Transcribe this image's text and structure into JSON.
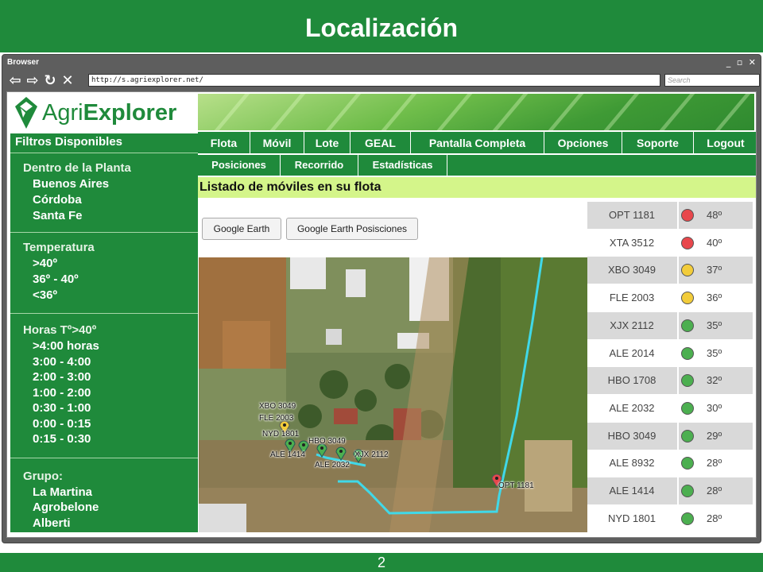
{
  "slide": {
    "title": "Localización",
    "page_number": "2"
  },
  "browser": {
    "title": "Browser",
    "url": "http://s.agriexplorer.net/",
    "search_placeholder": "Search",
    "window_controls": "_ ▫ ✕"
  },
  "logo": {
    "prefix": "Agri",
    "suffix": "Explorer"
  },
  "filters": {
    "title": "Filtros Disponibles",
    "sections": [
      {
        "title": "Dentro de la Planta",
        "items": [
          "Buenos Aires",
          "Córdoba",
          "Santa Fe"
        ]
      },
      {
        "title": "Temperatura",
        "items": [
          ">40º",
          "36º - 40º",
          "<36º"
        ]
      },
      {
        "title": "Horas Tº>40º",
        "items": [
          ">4:00 horas",
          "3:00 - 4:00",
          "2:00 - 3:00",
          "1:00 - 2:00",
          "0:30 - 1:00",
          "0:00 - 0:15",
          "0:15 - 0:30"
        ]
      },
      {
        "title": "Grupo:",
        "items": [
          "La Martina",
          "Agrobelone",
          "Alberti"
        ]
      }
    ]
  },
  "nav": {
    "items": [
      "Flota",
      "Móvil",
      "Lote",
      "GEAL",
      "Pantalla Completa",
      "Opciones",
      "Soporte",
      "Logout"
    ]
  },
  "subnav": {
    "items": [
      "Posiciones",
      "Recorrido",
      "Estadísticas"
    ]
  },
  "page_title": "Listado de móviles en su flota",
  "buttons": {
    "google_earth": "Google Earth",
    "google_earth_positions": "Google Earth Posisciones"
  },
  "status_colors": {
    "red": "#e8474c",
    "yellow": "#f2cc3a",
    "green": "#4caf50"
  },
  "fleet": [
    {
      "name": "OPT 1181",
      "status": "red",
      "temp": "48º"
    },
    {
      "name": "XTA 3512",
      "status": "red",
      "temp": "40º"
    },
    {
      "name": "XBO 3049",
      "status": "yellow",
      "temp": "37º"
    },
    {
      "name": "FLE 2003",
      "status": "yellow",
      "temp": "36º"
    },
    {
      "name": "XJX 2112",
      "status": "green",
      "temp": "35º"
    },
    {
      "name": "ALE 2014",
      "status": "green",
      "temp": "35º"
    },
    {
      "name": "HBO 1708",
      "status": "green",
      "temp": "32º"
    },
    {
      "name": "ALE 2032",
      "status": "green",
      "temp": "30º"
    },
    {
      "name": "HBO 3049",
      "status": "green",
      "temp": "29º"
    },
    {
      "name": "ALE 8932",
      "status": "green",
      "temp": "28º"
    },
    {
      "name": "ALE 1414",
      "status": "green",
      "temp": "28º"
    },
    {
      "name": "NYD 1801",
      "status": "green",
      "temp": "28º"
    }
  ],
  "map_labels": [
    "XBO 3049",
    "FLE 2003",
    "NYD 1801",
    "HBO 3049",
    "ALE 1414",
    "XJX 2112",
    "ALE 2032",
    "OPT 1181"
  ]
}
